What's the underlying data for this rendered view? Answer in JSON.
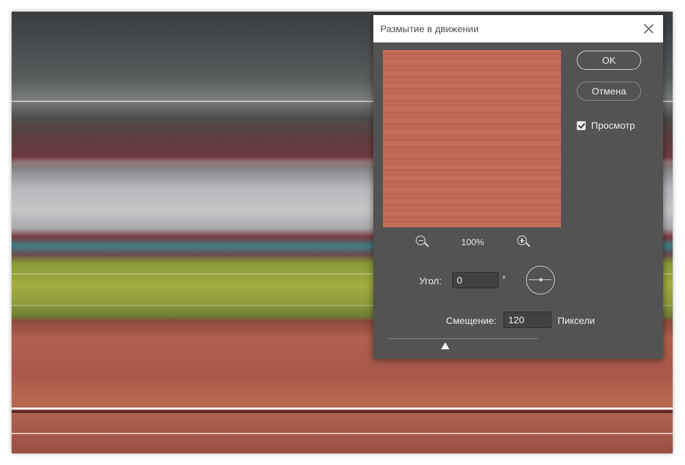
{
  "dialog": {
    "title": "Размытие в движении",
    "ok_label": "OK",
    "cancel_label": "Отмена",
    "preview_label": "Просмотр",
    "preview_checked": true,
    "zoom_level": "100%",
    "angle_label": "Угол:",
    "angle_value": "0",
    "angle_unit": "°",
    "distance_label": "Смещение:",
    "distance_value": "120",
    "distance_unit": "Пиксели"
  },
  "icons": {
    "close": "close-icon",
    "zoom_out": "zoom-out-icon",
    "zoom_in": "zoom-in-icon",
    "angle_dial": "angle-dial-icon"
  },
  "colors": {
    "dialog_bg": "#535353",
    "preview_tone": "#c06a56"
  }
}
